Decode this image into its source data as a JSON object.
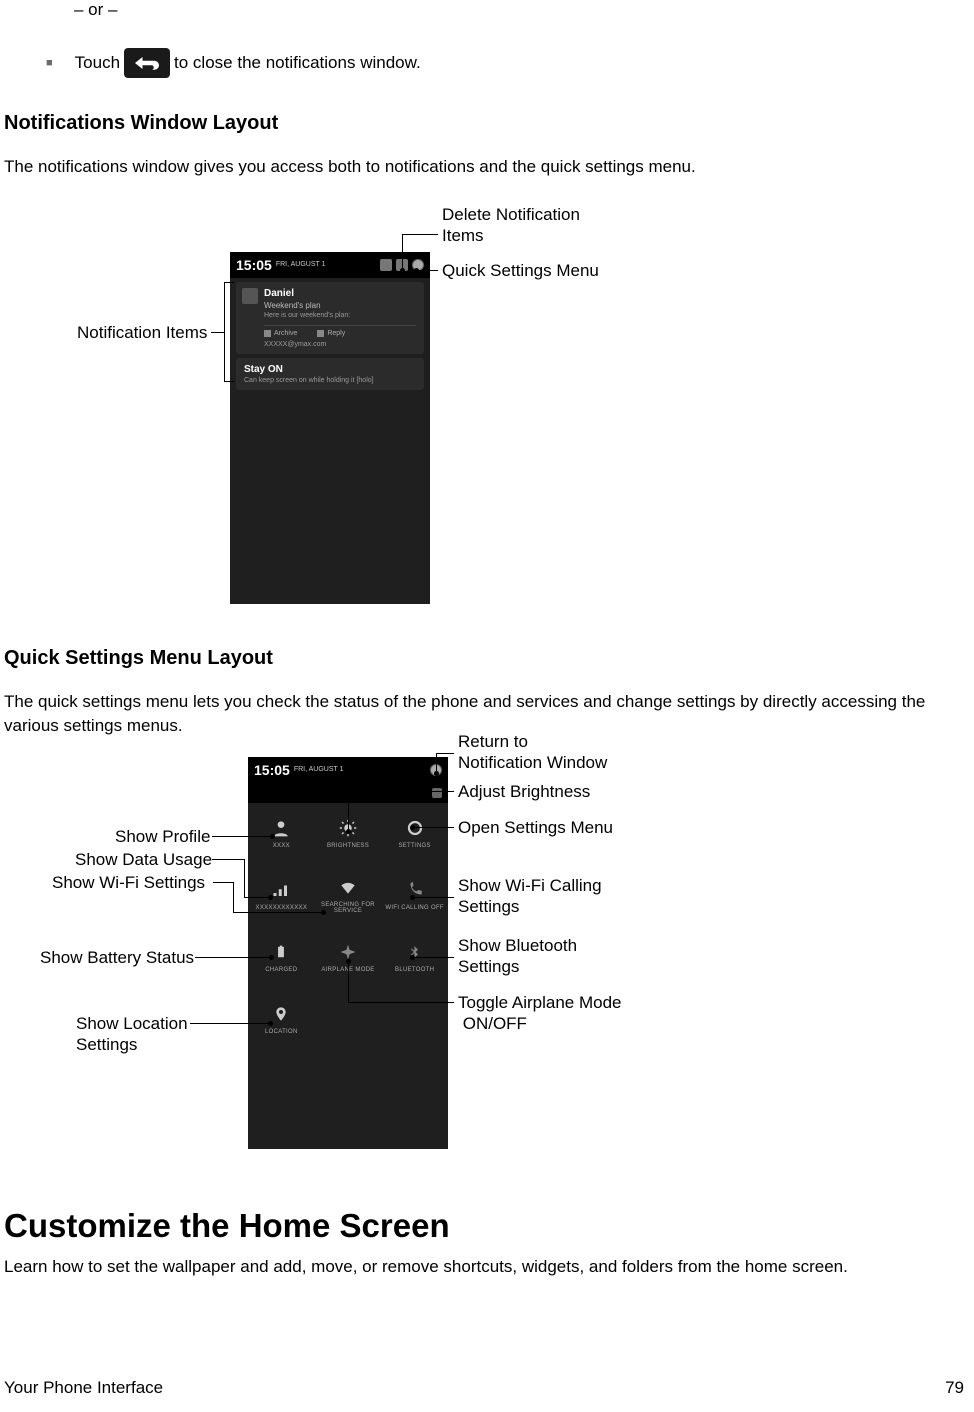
{
  "intro": {
    "or": "– or –",
    "touch_before": "Touch",
    "touch_after": "to close the notifications window."
  },
  "section1": {
    "heading": "Notifications Window Layout",
    "para": "The notifications window gives you access both to notifications and the quick settings menu.",
    "callouts": {
      "delete": "Delete Notification\nItems",
      "quick": "Quick Settings Menu",
      "items": "Notification Items"
    },
    "phone": {
      "time": "15:05",
      "date": "FRI, AUGUST 1",
      "n1_title": "Daniel",
      "n1_sub": "Weekend's plan",
      "n1_body": "Here is our weekend's plan:",
      "n1_a1": "Archive",
      "n1_a2": "Reply",
      "n1_email": "XXXXX@ymax.com",
      "n2_title": "Stay ON",
      "n2_body": "Can keep screen on while holding it [holo]"
    }
  },
  "section2": {
    "heading": "Quick Settings Menu Layout",
    "para": "The quick settings menu lets you check the status of the phone and services and change settings by directly accessing the various settings menus.",
    "callouts_left": {
      "profile": "Show Profile",
      "data": "Show Data Usage",
      "wifi": "Show Wi-Fi Settings",
      "battery": "Show Battery Status",
      "location": "Show Location\nSettings"
    },
    "callouts_right": {
      "return": "Return to\nNotification Window",
      "brightness": "Adjust Brightness",
      "settings": "Open Settings Menu",
      "wificall": "Show Wi-Fi Calling\nSettings",
      "bluetooth": "Show Bluetooth\nSettings",
      "airplane": "Toggle Airplane Mode\n ON/OFF"
    },
    "phone": {
      "time": "15:05",
      "date": "FRI, AUGUST 1",
      "tiles": {
        "profile": "XXXX",
        "brightness": "BRIGHTNESS",
        "settings": "SETTINGS",
        "data": "XXXXXXXXXXXX",
        "wifi_searching": "SEARCHING FOR\nSERVICE",
        "wifi_call": "WIFI CALLING OFF",
        "battery": "CHARGED",
        "airplane": "AIRPLANE MODE",
        "bluetooth": "BLUETOOTH",
        "location": "LOCATION"
      }
    }
  },
  "section3": {
    "heading": "Customize the Home Screen",
    "para": "Learn how to set the wallpaper and add, move, or remove shortcuts, widgets, and folders from the home screen."
  },
  "footer": {
    "left": "Your Phone Interface",
    "right": "79"
  }
}
